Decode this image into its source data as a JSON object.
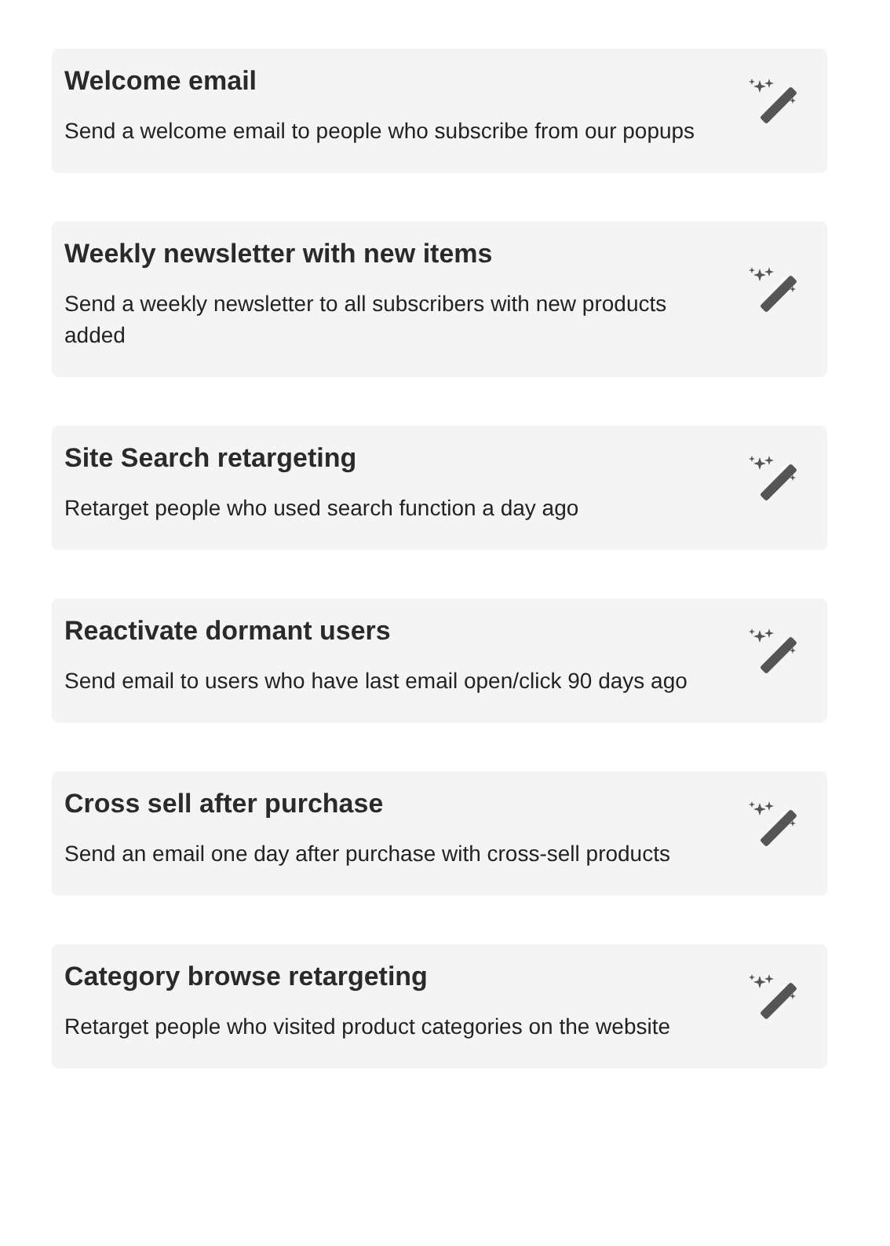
{
  "templates": [
    {
      "title": "Welcome email",
      "description": "Send a welcome email to people who subscribe from our popups"
    },
    {
      "title": "Weekly newsletter with new items",
      "description": "Send a weekly newsletter to all subscribers with new products added"
    },
    {
      "title": "Site Search retargeting",
      "description": "Retarget people who used search function a day ago"
    },
    {
      "title": "Reactivate dormant users",
      "description": "Send email to users who have last email open/click 90 days ago"
    },
    {
      "title": "Cross sell after purchase",
      "description": "Send an email one day after purchase with cross-sell products"
    },
    {
      "title": "Category browse retargeting",
      "description": "Retarget people who visited product categories on the website"
    }
  ]
}
